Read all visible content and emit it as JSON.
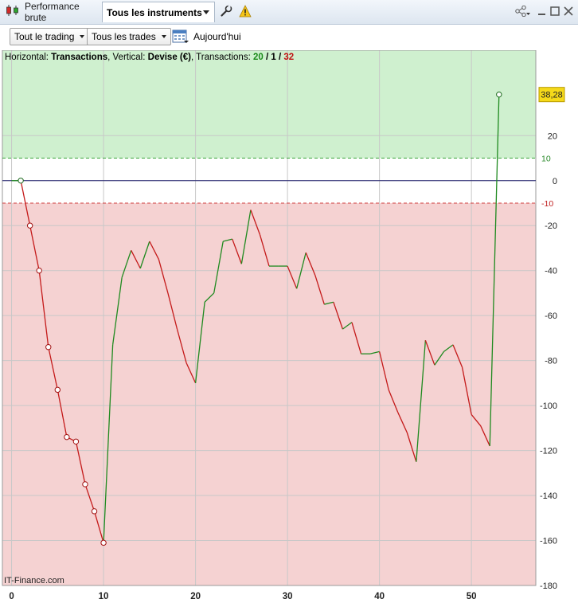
{
  "titlebar": {
    "tab_performance": "Performance brute",
    "tab_instruments": "Tous les instruments"
  },
  "toolbar": {
    "dropdown_trading": "Tout le trading",
    "dropdown_trades": "Tous les trades",
    "today_label": "Aujourd'hui"
  },
  "info": {
    "horizontal_label": "Horizontal:",
    "horizontal_value": "Transactions",
    "vertical_label": ", Vertical:",
    "vertical_value": "Devise (€)",
    "transactions_label": ", Transactions:",
    "wins": "20",
    "sep1": " / ",
    "neutral": "1",
    "sep2": " / ",
    "losses": "32"
  },
  "credit": "IT-Finance.com",
  "colors": {
    "profit_zone": "#cff0cf",
    "loss_zone": "#f5d2d2",
    "up_line": "#1f8a1f",
    "down_line": "#c41a1a",
    "last_value_badge": "#f5d91a"
  },
  "chart_data": {
    "type": "line",
    "xlabel": "Transactions",
    "ylabel": "Devise (€)",
    "x": [
      0,
      1,
      2,
      3,
      4,
      5,
      6,
      7,
      8,
      9,
      10,
      11,
      12,
      13,
      14,
      15,
      16,
      17,
      18,
      19,
      20,
      21,
      22,
      23,
      24,
      25,
      26,
      27,
      28,
      29,
      30,
      31,
      32,
      33,
      34,
      35,
      36,
      37,
      38,
      39,
      40,
      41,
      42,
      43,
      44,
      45,
      46,
      47,
      48,
      49,
      50,
      51,
      52,
      53
    ],
    "values": [
      0,
      0,
      -20,
      -40,
      -74,
      -93,
      -114,
      -116,
      -135,
      -147,
      -161,
      -73,
      -43,
      -31,
      -39,
      -27,
      -35,
      -50,
      -66,
      -81,
      -90,
      -54,
      -50,
      -27,
      -26,
      -37,
      -13,
      -24,
      -38,
      -38,
      -38,
      -48,
      -32,
      -42,
      -55,
      -54,
      -66,
      -63,
      -77,
      -77,
      -76,
      -93,
      -103,
      -112,
      -125,
      -71,
      -82,
      -76,
      -73,
      -83,
      -104,
      -109,
      -118,
      38.28
    ],
    "markers_x": [
      1,
      2,
      3,
      4,
      5,
      6,
      7,
      8,
      9,
      10,
      53
    ],
    "last_value": "38,28",
    "threshold_upper": 10,
    "threshold_lower": -10,
    "threshold_upper_label": "10",
    "threshold_lower_label": "-10",
    "xlim": [
      -1,
      57
    ],
    "ylim": [
      -180,
      58
    ],
    "x_ticks": [
      0,
      10,
      20,
      30,
      40,
      50
    ],
    "y_ticks": [
      20,
      0,
      -20,
      -40,
      -60,
      -80,
      -100,
      -120,
      -140,
      -160,
      -180
    ],
    "grid": true
  }
}
